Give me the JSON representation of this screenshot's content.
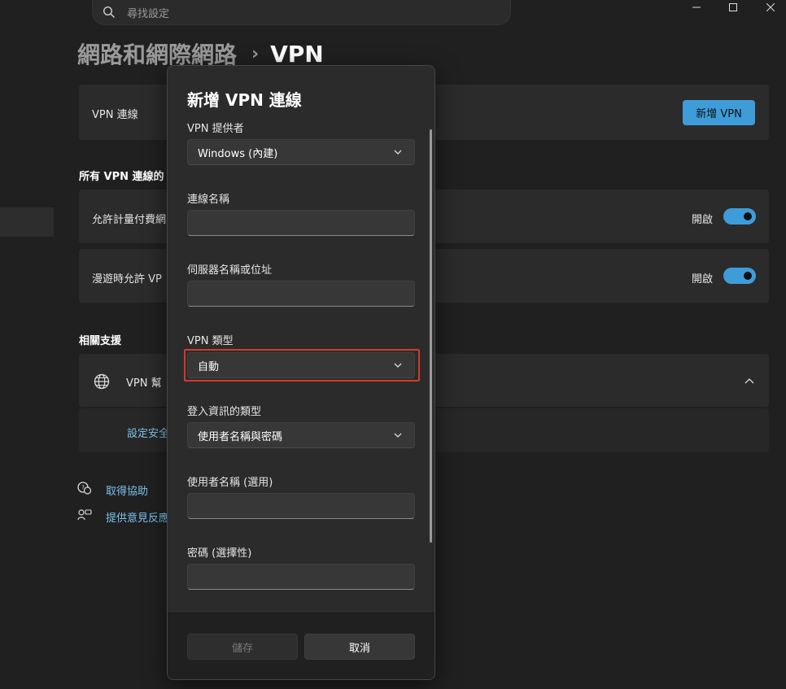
{
  "search": {
    "placeholder": "尋找設定",
    "icon": "search-icon"
  },
  "window_controls": [
    "minimize-icon",
    "maximize-icon",
    "close-icon"
  ],
  "breadcrumb": {
    "parent": "網路和網際網路",
    "separator": "›",
    "current": "VPN"
  },
  "vpn_connections": {
    "label": "VPN 連線",
    "add_button": "新增 VPN"
  },
  "advanced": {
    "title": "所有 VPN 連線的",
    "metered": {
      "label": "允許計量付費網",
      "state": "開啟",
      "on": true
    },
    "roaming": {
      "label": "漫遊時允許 VP",
      "state": "開啟",
      "on": true
    }
  },
  "related": {
    "title": "相關支援",
    "help_item": {
      "label": "VPN 幫",
      "icon": "globe-icon"
    },
    "link": "設定安全"
  },
  "footer_links": {
    "get_help": "取得協助",
    "feedback": "提供意見反應"
  },
  "dialog": {
    "title": "新增 VPN 連線",
    "provider": {
      "label": "VPN 提供者",
      "value": "Windows (內建)"
    },
    "connection_name": {
      "label": "連線名稱",
      "value": ""
    },
    "server": {
      "label": "伺服器名稱或位址",
      "value": ""
    },
    "vpn_type": {
      "label": "VPN 類型",
      "value": "自動"
    },
    "signin_type": {
      "label": "登入資訊的類型",
      "value": "使用者名稱與密碼"
    },
    "username": {
      "label": "使用者名稱 (選用)",
      "value": ""
    },
    "password": {
      "label": "密碼 (選擇性)",
      "value": ""
    },
    "save_button": "儲存",
    "cancel_button": "取消"
  },
  "colors": {
    "accent": "#3e9cd8",
    "focus_ring": "#d33a2c",
    "background": "#202020",
    "card": "#2b2b2b"
  }
}
